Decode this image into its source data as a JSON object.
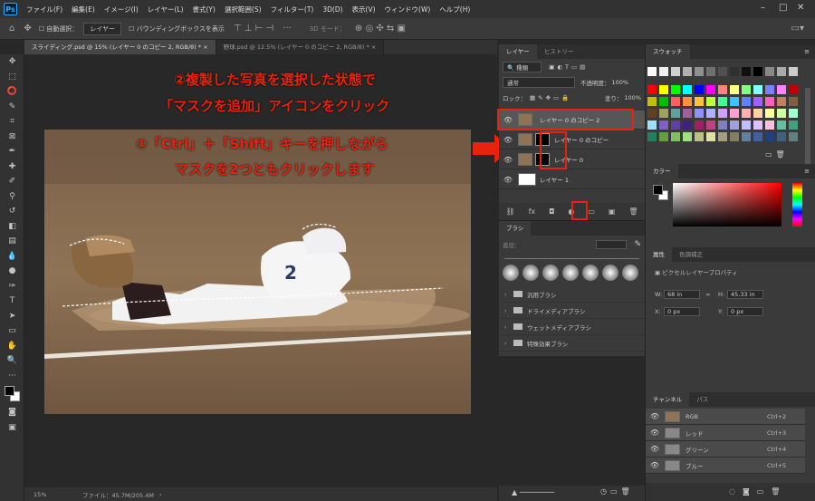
{
  "menubar": {
    "logo": "Ps",
    "items": [
      "ファイル(F)",
      "編集(E)",
      "イメージ(I)",
      "レイヤー(L)",
      "書式(Y)",
      "選択範囲(S)",
      "フィルター(T)",
      "3D(D)",
      "表示(V)",
      "ウィンドウ(W)",
      "ヘルプ(H)"
    ]
  },
  "options": {
    "auto_select": "自動選択：",
    "target": "レイヤー",
    "bounding_box": "バウンディングボックスを表示",
    "mode_3d": "3D モード："
  },
  "tabs": [
    {
      "label": "スライディング.psd @ 15% (レイヤー 0 のコピー 2, RGB/8) *",
      "close": "×"
    },
    {
      "label": "野球.psd @ 12.5% (レイヤー 0 のコピー 2, RGB/8) *",
      "close": "×"
    }
  ],
  "status": {
    "zoom": "15%",
    "file": "ファイル：45.7M/205.4M"
  },
  "notes": {
    "line1": "②複製した写真を選択した状態で",
    "line2": "「マスクを追加」アイコンをクリック",
    "line3": "①「Ctrl」＋「Shift」キーを押しながら",
    "line4": "マスクを2つともクリックします"
  },
  "layers_panel": {
    "tabs": [
      "レイヤー",
      "ヒストリー"
    ],
    "kind": "種類",
    "blend": "通常",
    "opacity_label": "不透明度：",
    "opacity": "100%",
    "lock_label": "ロック：",
    "fill_label": "塗り：",
    "fill": "100%",
    "layers": [
      {
        "name": "レイヤー 0 のコピー 2"
      },
      {
        "name": "レイヤー 0 のコピー"
      },
      {
        "name": "レイヤー 0"
      },
      {
        "name": "レイヤー 1"
      }
    ],
    "footer": [
      "⛓",
      "fx",
      "◘",
      "◐",
      "▭",
      "▣",
      "🗑"
    ]
  },
  "brush_panel": {
    "title": "ブラシ",
    "size_label": "直径：",
    "folders": [
      "汎用ブラシ",
      "ドライメディアブラシ",
      "ウェットメディアブラシ",
      "特殊効果ブラシ"
    ]
  },
  "swatches_panel": {
    "title": "スウォッチ"
  },
  "color_panel": {
    "title": "カラー"
  },
  "properties_panel": {
    "tabs": [
      "属性",
      "色調補正"
    ],
    "subtitle": "ピクセルレイヤープロパティ",
    "w_label": "W:",
    "w": "68 in",
    "h_label": "H:",
    "h": "45.33 in",
    "x_label": "X:",
    "x": "0 px",
    "y_label": "Y:",
    "y": "0 px",
    "link": "∞"
  },
  "channels_panel": {
    "tabs": [
      "チャンネル",
      "パス"
    ],
    "channels": [
      {
        "name": "RGB",
        "shortcut": "Ctrl+2"
      },
      {
        "name": "レッド",
        "shortcut": "Ctrl+3"
      },
      {
        "name": "グリーン",
        "shortcut": "Ctrl+4"
      },
      {
        "name": "ブルー",
        "shortcut": "Ctrl+5"
      }
    ]
  }
}
